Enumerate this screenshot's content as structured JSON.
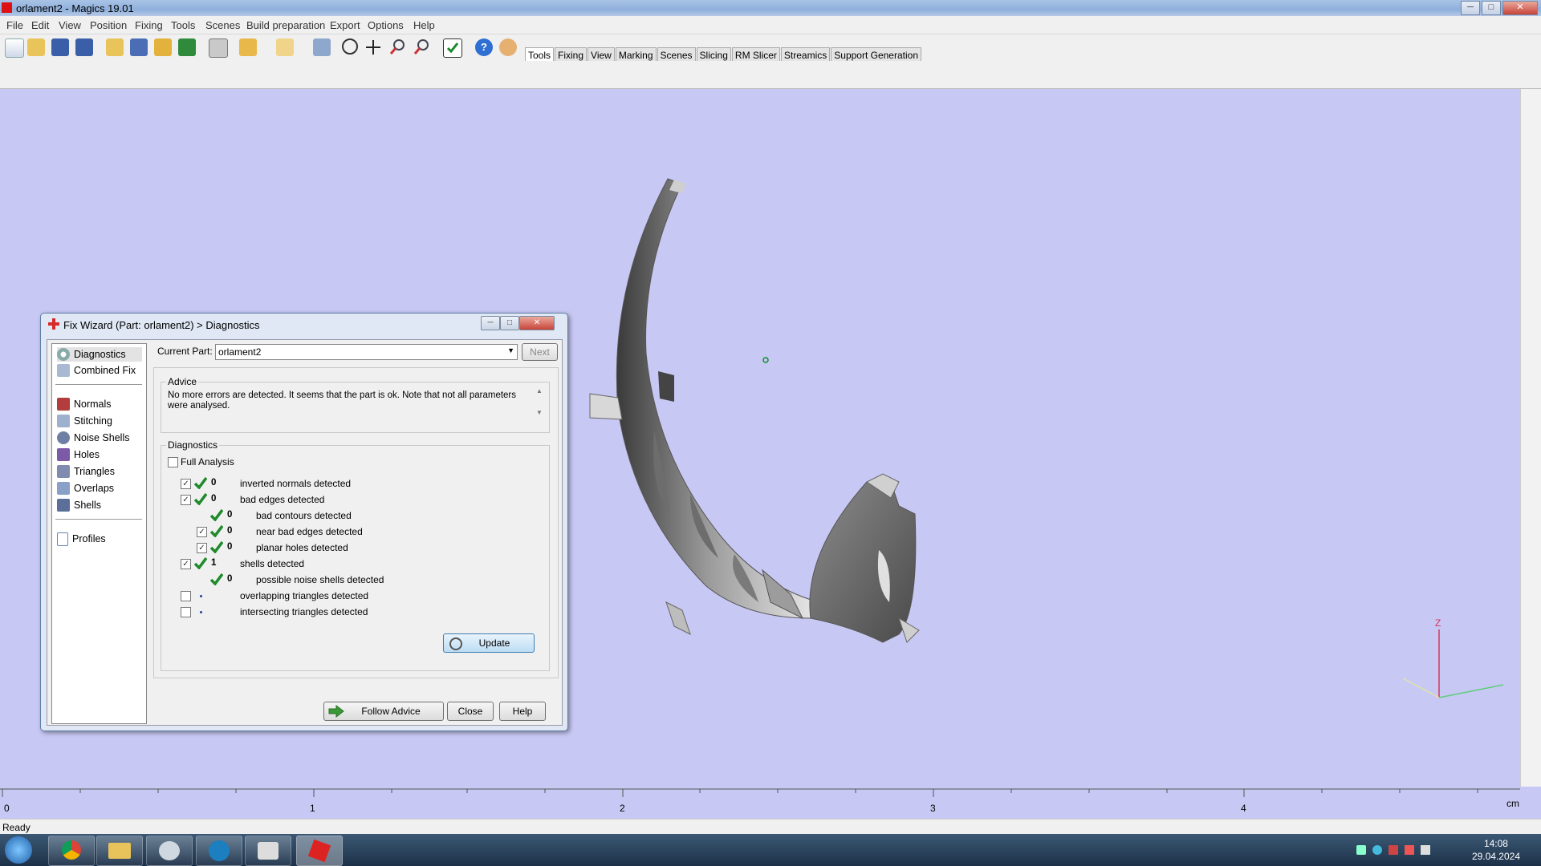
{
  "window": {
    "title": "orlament2 - Magics 19.01"
  },
  "menu": [
    "File",
    "Edit",
    "View",
    "Position",
    "Fixing",
    "Tools",
    "Scenes",
    "Build preparation",
    "Export",
    "Options",
    "Help"
  ],
  "tabs": [
    "Tools",
    "Fixing",
    "View",
    "Marking",
    "Scenes",
    "Slicing",
    "RM Slicer",
    "Streamics",
    "Support Generation"
  ],
  "active_tab": "Tools",
  "dialog": {
    "title": "Fix Wizard (Part: orlament2) > Diagnostics",
    "nav": {
      "top": [
        "Diagnostics",
        "Combined Fix"
      ],
      "tools": [
        "Normals",
        "Stitching",
        "Noise Shells",
        "Holes",
        "Triangles",
        "Overlaps",
        "Shells"
      ],
      "bottom": [
        "Profiles"
      ]
    },
    "current_part_label": "Current Part:",
    "current_part_value": "orlament2",
    "next_label": "Next",
    "advice_title": "Advice",
    "advice_text": "No more errors are detected. It seems that the part is ok. Note that not all parameters were analysed.",
    "diagnostics_title": "Diagnostics",
    "full_analysis_label": "Full Analysis",
    "rows": [
      {
        "checked": true,
        "ok": true,
        "count": "0",
        "label": "inverted normals detected",
        "indent": 0,
        "has_checkbox": true
      },
      {
        "checked": true,
        "ok": true,
        "count": "0",
        "label": "bad edges detected",
        "indent": 0,
        "has_checkbox": true
      },
      {
        "checked": false,
        "ok": true,
        "count": "0",
        "label": "bad contours detected",
        "indent": 1,
        "has_checkbox": false
      },
      {
        "checked": true,
        "ok": true,
        "count": "0",
        "label": "near bad edges detected",
        "indent": 1,
        "has_checkbox": true
      },
      {
        "checked": true,
        "ok": true,
        "count": "0",
        "label": "planar holes detected",
        "indent": 1,
        "has_checkbox": true
      },
      {
        "checked": true,
        "ok": true,
        "count": "1",
        "label": "shells detected",
        "indent": 0,
        "has_checkbox": true
      },
      {
        "checked": false,
        "ok": true,
        "count": "0",
        "label": "possible noise shells detected",
        "indent": 1,
        "has_checkbox": false
      },
      {
        "checked": false,
        "ok": false,
        "count": "",
        "label": "overlapping triangles detected",
        "indent": 0,
        "has_checkbox": true
      },
      {
        "checked": false,
        "ok": false,
        "count": "",
        "label": "intersecting triangles detected",
        "indent": 0,
        "has_checkbox": true
      }
    ],
    "update_label": "Update",
    "follow_advice_label": "Follow Advice",
    "close_label": "Close",
    "help_label": "Help"
  },
  "ruler": {
    "labels": [
      "0",
      "1",
      "2",
      "3",
      "4"
    ],
    "unit": "cm"
  },
  "axis_label": "Z",
  "status": "Ready",
  "clock": {
    "time": "14:08",
    "date": "29.04.2024"
  },
  "colors": {
    "viewport": "#c8c8f4",
    "check": "#1f8a2c",
    "close_red": "#c8443a"
  }
}
